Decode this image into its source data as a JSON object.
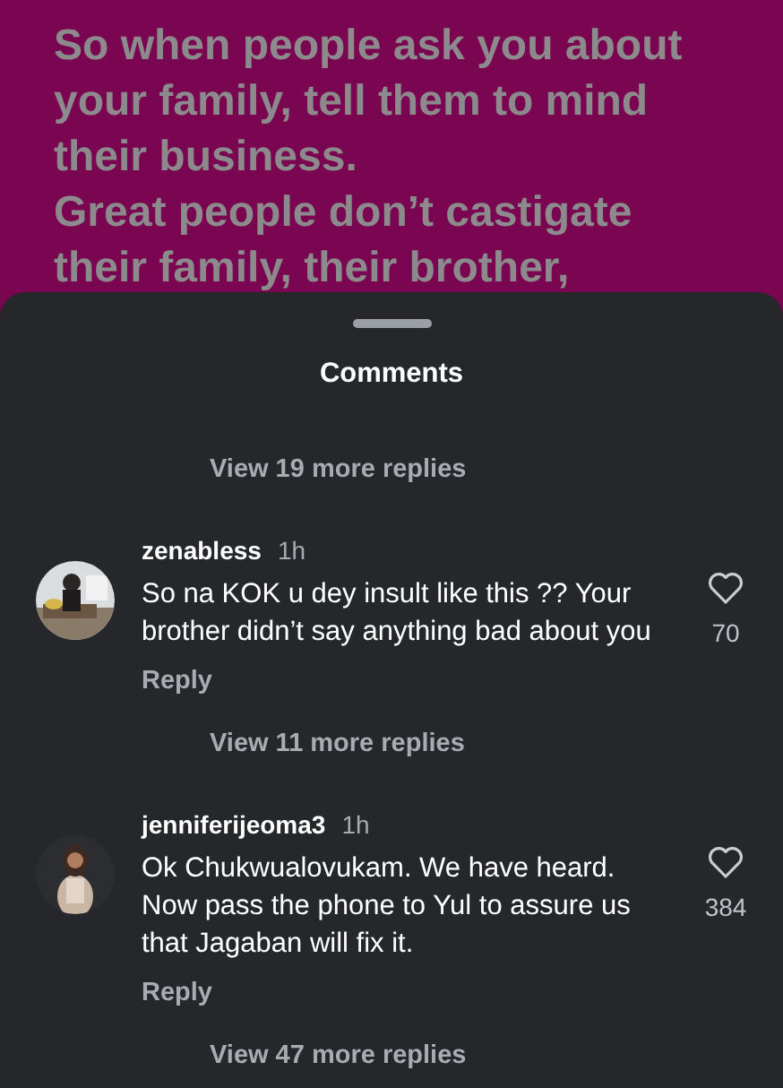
{
  "story": {
    "text": "So when people ask you about your family, tell them to mind their business.\nGreat people don’t castigate their family, their brother,"
  },
  "sheet": {
    "title": "Comments"
  },
  "items": [
    {
      "kind": "more",
      "label": "View 19 more replies"
    },
    {
      "kind": "comment",
      "username": "zenabless",
      "time": "1h",
      "text": "So na KOK u dey insult like this ?? Your brother didn’t say anything bad about you",
      "likes": "70",
      "reply": "Reply"
    },
    {
      "kind": "more",
      "label": "View 11 more replies"
    },
    {
      "kind": "comment",
      "username": "jenniferijeoma3",
      "time": "1h",
      "text": "Ok Chukwualovukam. We have heard. Now pass the phone to Yul to assure us that Jagaban will fix it.",
      "likes": "384",
      "reply": "Reply"
    },
    {
      "kind": "more",
      "label": "View 47 more replies"
    }
  ]
}
